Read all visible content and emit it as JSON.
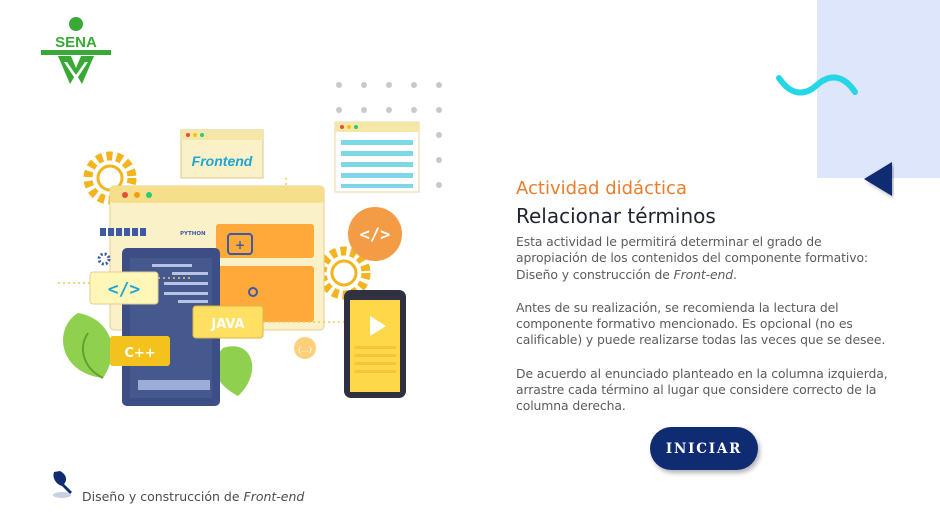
{
  "brand": {
    "logo_text": "SENA",
    "color": "#39a935"
  },
  "colors": {
    "accent": "#ea7c2c",
    "navy": "#0f2b72",
    "panel": "#dde6fb",
    "wave": "#25d7e6"
  },
  "illustration": {
    "window_label": "Frontend",
    "badge_java": "JAVA",
    "badge_cpp": "C++",
    "code_symbol": "</>",
    "bracket_symbol": "{...}",
    "plus_symbol": "+",
    "python_label": "PYTHON"
  },
  "activity": {
    "subtitle": "Actividad didáctica",
    "title": "Relacionar términos",
    "p1_main": "Esta actividad le permitirá determinar el grado de apropiación de los contenidos del componente formativo: Diseño y construcción de ",
    "p1_em": "Front-end",
    "p1_end": ".",
    "p2": "Antes de su realización, se recomienda la lectura del componente formativo mencionado. Es opcional (no es calificable) y puede realizarse todas las veces que se desee.",
    "p3": "De acuerdo al enunciado planteado en la columna izquierda, arrastre cada término al lugar que considere correcto de la columna derecha."
  },
  "start_button": {
    "label": "INICIAR"
  },
  "footer": {
    "text": "Diseño y construcción de ",
    "em": "Front-end",
    "icon": "pushpin-icon"
  }
}
